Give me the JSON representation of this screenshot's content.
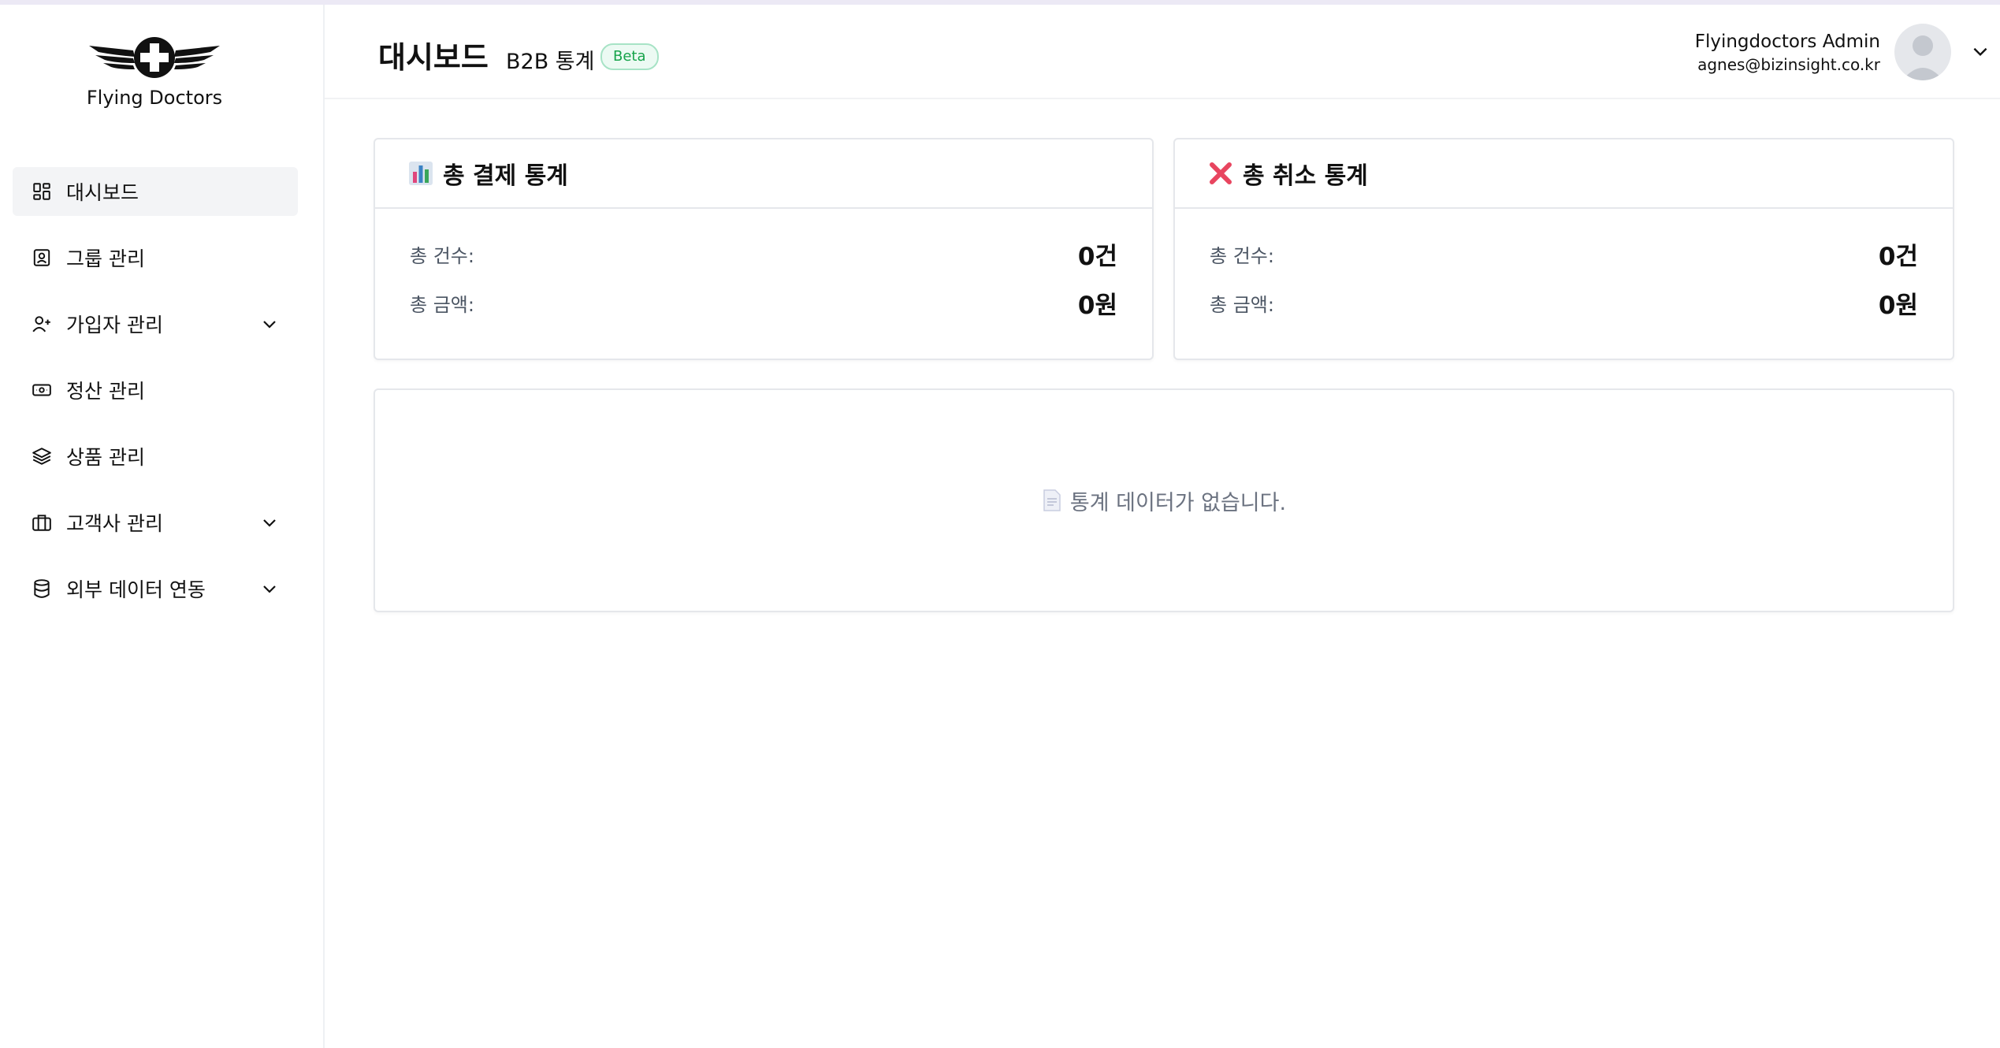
{
  "app": {
    "logo_text": "Flying Doctors"
  },
  "sidebar": {
    "items": [
      {
        "label": "대시보드",
        "icon": "dashboard-icon",
        "active": true
      },
      {
        "label": "그룹 관리",
        "icon": "group-icon"
      },
      {
        "label": "가입자 관리",
        "icon": "user-plus-icon",
        "expandable": true
      },
      {
        "label": "정산 관리",
        "icon": "banknote-icon"
      },
      {
        "label": "상품 관리",
        "icon": "layers-icon"
      },
      {
        "label": "고객사 관리",
        "icon": "briefcase-icon",
        "expandable": true
      },
      {
        "label": "외부 데이터 연동",
        "icon": "database-icon",
        "expandable": true
      }
    ]
  },
  "header": {
    "title": "대시보드",
    "subtitle": "B2B 통계",
    "badge": "Beta",
    "user_name": "Flyingdoctors Admin",
    "user_email": "agnes@bizinsight.co.kr"
  },
  "cards": {
    "payment": {
      "title": "총 결제 통계",
      "icon": "bar-chart-emoji-icon",
      "count_label": "총 건수:",
      "count_value": "0건",
      "amount_label": "총 금액:",
      "amount_value": "0원"
    },
    "cancel": {
      "title": "총 취소 통계",
      "icon": "cross-mark-emoji-icon",
      "count_label": "총 건수:",
      "count_value": "0건",
      "amount_label": "총 금액:",
      "amount_value": "0원"
    }
  },
  "empty_state": {
    "message": "통계 데이터가 없습니다."
  },
  "colors": {
    "accent_green": "#16a34a",
    "badge_bg": "#ecfaf3",
    "cancel_red": "#e8455f"
  }
}
